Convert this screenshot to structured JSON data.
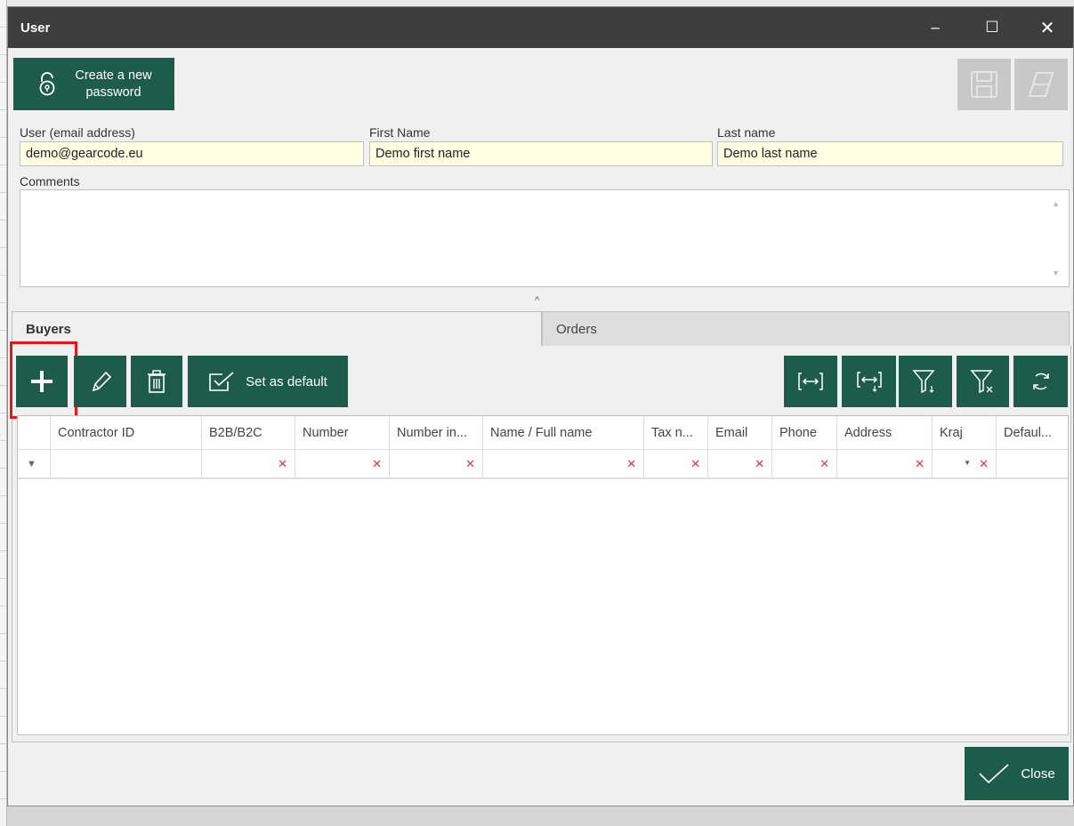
{
  "window": {
    "title": "User",
    "controls": {
      "minimize": "–",
      "maximize": "☐",
      "close": "✕"
    }
  },
  "toolbar_top": {
    "create_password_label_line1": "Create a new",
    "create_password_label_line2": "password",
    "save_icon": "save-icon",
    "erase_icon": "eraser-icon"
  },
  "form": {
    "email_label": "User (email address)",
    "email_value": "demo@gearcode.eu",
    "first_name_label": "First Name",
    "first_name_value": "Demo first name",
    "last_name_label": "Last name",
    "last_name_value": "Demo last name",
    "comments_label": "Comments",
    "comments_value": ""
  },
  "tabs": [
    {
      "label": "Buyers",
      "active": true
    },
    {
      "label": "Orders",
      "active": false
    }
  ],
  "buyers_toolbar": {
    "add_icon": "plus-icon",
    "edit_icon": "pencil-icon",
    "delete_icon": "trash-icon",
    "set_default_label": "Set as default",
    "right_icons": [
      "fit-columns-icon",
      "fit-columns-down-icon",
      "filter-down-icon",
      "filter-clear-icon",
      "refresh-icon"
    ]
  },
  "grid": {
    "columns": [
      "Contractor ID",
      "B2B/B2C",
      "Number",
      "Number in...",
      "Name / Full name",
      "Tax n...",
      "Email",
      "Phone",
      "Address",
      "Kraj",
      "Defaul..."
    ],
    "rows": []
  },
  "footer": {
    "close_label": "Close"
  },
  "colors": {
    "accent_green": "#1e5c4a",
    "titlebar": "#3d3d3d",
    "input_bg": "#fefee2",
    "highlight_red": "#e3161a"
  }
}
